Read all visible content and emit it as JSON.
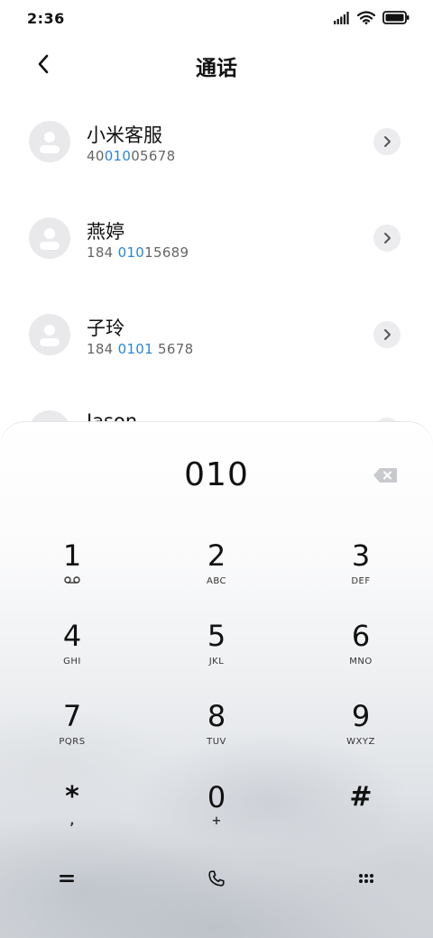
{
  "status_bar": {
    "time": "2:36",
    "icons": [
      "signal-icon",
      "wifi-icon",
      "battery-icon"
    ]
  },
  "header": {
    "title": "通话",
    "back_icon": "chevron-left-icon"
  },
  "contacts": [
    {
      "name": "小米客服",
      "number_before": "40",
      "number_match": "010",
      "number_after": "05678"
    },
    {
      "name": "燕婷",
      "number_before": "184 ",
      "number_match": "010",
      "number_after": "15689"
    },
    {
      "name": "子玲",
      "number_before": "184 ",
      "number_match": "0101",
      "number_after": " 5678"
    },
    {
      "name": "Jason",
      "number_before": "",
      "number_match": "",
      "number_after": ""
    }
  ],
  "colors": {
    "match_highlight": "#2c85d6",
    "avatar_bg": "#e9e9ec",
    "text_primary": "#111111",
    "text_secondary": "#666666"
  },
  "dialpad": {
    "input": "010",
    "keys": [
      {
        "digit": "1",
        "letters": ""
      },
      {
        "digit": "2",
        "letters": "ABC"
      },
      {
        "digit": "3",
        "letters": "DEF"
      },
      {
        "digit": "4",
        "letters": "GHI"
      },
      {
        "digit": "5",
        "letters": "JKL"
      },
      {
        "digit": "6",
        "letters": "MNO"
      },
      {
        "digit": "7",
        "letters": "PQRS"
      },
      {
        "digit": "8",
        "letters": "TUV"
      },
      {
        "digit": "9",
        "letters": "WXYZ"
      },
      {
        "digit": "*",
        "letters": ","
      },
      {
        "digit": "0",
        "letters": "+"
      },
      {
        "digit": "#",
        "letters": ""
      }
    ],
    "key1_sub_icon": "voicemail-icon",
    "bottom_buttons": [
      "menu-icon",
      "phone-icon",
      "dialpad-grid-icon"
    ]
  }
}
